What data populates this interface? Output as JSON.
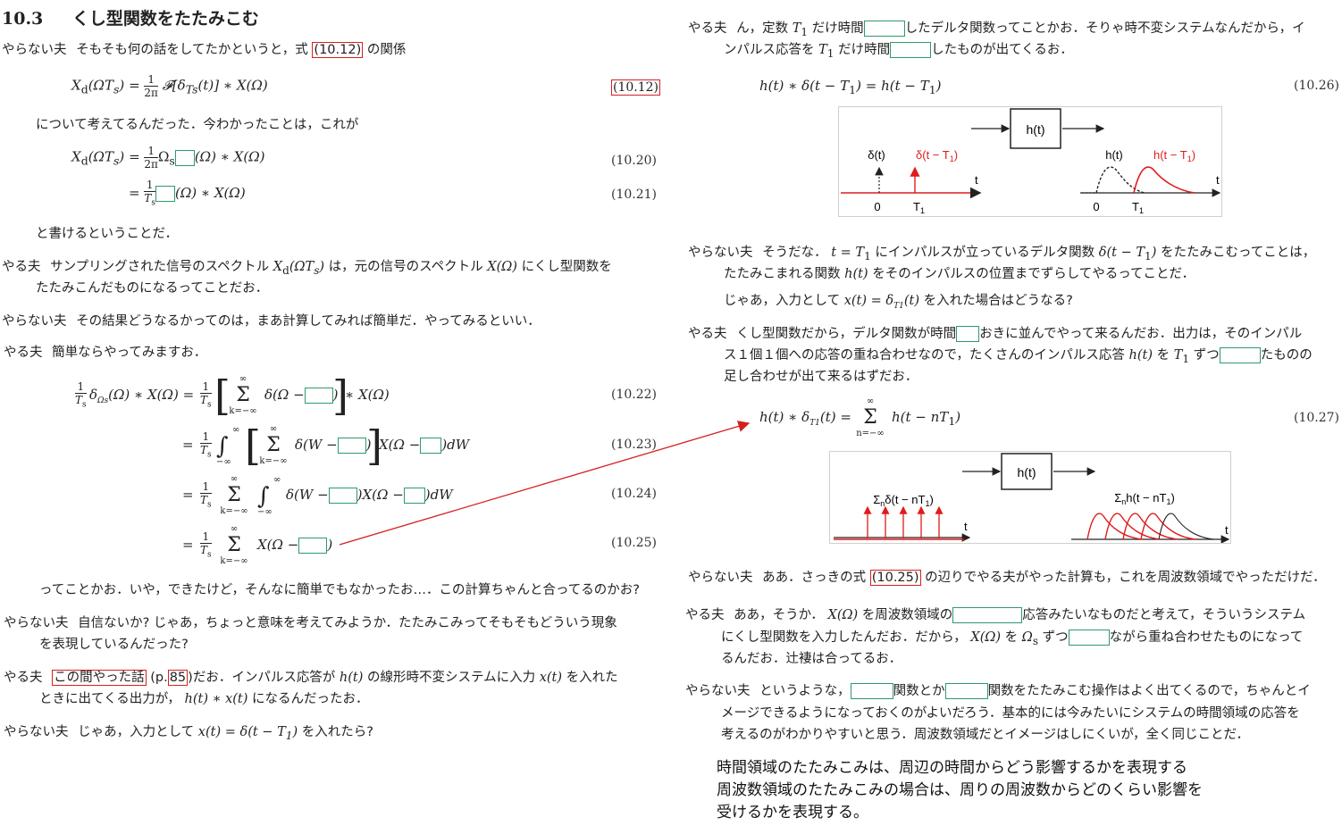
{
  "section": {
    "number": "10.3",
    "title": "くし型関数をたたみこむ"
  },
  "left": {
    "p1": {
      "speaker": "やらない夫",
      "text_a": "そもそも何の話をしてたかというと，式",
      "ref": "(10.12)",
      "text_b": "の関係"
    },
    "eq1": {
      "lhs": "X",
      "lhs_sub": "d",
      "lhs_arg": "(ΩT",
      "lhs_arg_sub": "s",
      "lhs_arg_end": ")",
      "eq": "=",
      "num": "1",
      "den": "2π",
      "rhs": "𝓕[δ",
      "rhs_sub": "Ts",
      "rhs_end": "(t)] ∗ X(Ω)",
      "no": "(10.12)"
    },
    "p2": {
      "text": "について考えてるんだった．今わかったことは，これが"
    },
    "eq2": {
      "lhs": "X",
      "lhs_sub": "d",
      "lhs_arg": "(ΩT",
      "lhs_arg_sub": "s",
      "lhs_arg_end": ")",
      "eq": "=",
      "num": "1",
      "den": "2π",
      "omega": "Ω",
      "omega_sub": "s",
      "rhs": "(Ω) ∗ X(Ω)",
      "no": "(10.20)"
    },
    "eq3": {
      "eq": "=",
      "num": "1",
      "den": "T",
      "den_sub": "s",
      "rhs": "(Ω) ∗ X(Ω)",
      "no": "(10.21)"
    },
    "p3": {
      "text": "と書けるということだ．"
    },
    "p4": {
      "speaker": "やる夫",
      "text_a": "サンプリングされた信号のスペクトル",
      "math_a": "X",
      "math_a_sub": "d",
      "math_a_arg": "(ΩT",
      "math_a_arg_sub": "s",
      "math_a_end": ")",
      "text_b": "は，元の信号のスペクトル",
      "math_b": "X(Ω)",
      "text_c": "にくし型関数を",
      "text_d": "たたみこんだものになるってことだお．"
    },
    "p5": {
      "speaker": "やらない夫",
      "text": "その結果どうなるかってのは，まあ計算してみれば簡単だ．やってみるといい．"
    },
    "p6": {
      "speaker": "やる夫",
      "text": "簡単ならやってみますお．"
    },
    "eq4": {
      "lhs_num": "1",
      "lhs_den": "T",
      "lhs_den_sub": "s",
      "delta": "δ",
      "delta_sub": "Ωs",
      "lhs_end": "(Ω) ∗ X(Ω) =",
      "num": "1",
      "den": "T",
      "den_sub": "s",
      "sum_top": "∞",
      "sum_bot": "k=−∞",
      "sum": "Σ",
      "body": "δ(Ω −",
      "close": ")",
      "tail": "∗ X(Ω)",
      "no": "(10.22)"
    },
    "eq5": {
      "eq": "=",
      "num": "1",
      "den": "T",
      "den_sub": "s",
      "int_top": "∞",
      "int_bot": "−∞",
      "int": "∫",
      "sum_top": "∞",
      "sum_bot": "k=−∞",
      "sum": "Σ",
      "body": "δ(W −",
      "mid": "X(Ω −",
      "tail": ")dW",
      "no": "(10.23)"
    },
    "eq6": {
      "eq": "=",
      "num": "1",
      "den": "T",
      "den_sub": "s",
      "sum_top": "∞",
      "sum_bot": "k=−∞",
      "sum": "Σ",
      "int_top": "∞",
      "int_bot": "−∞",
      "int": "∫",
      "body": "δ(W −",
      "mid": ")X(Ω −",
      "tail": ")dW",
      "no": "(10.24)"
    },
    "eq7": {
      "eq": "=",
      "num": "1",
      "den": "T",
      "den_sub": "s",
      "sum_top": "∞",
      "sum_bot": "k=−∞",
      "sum": "Σ",
      "body": "X(Ω −",
      "close": ")",
      "no": "(10.25)"
    },
    "p7": {
      "text": "ってことかお．いや，できたけど，そんなに簡単でもなかったお…．この計算ちゃんと合ってるのかお?"
    },
    "p8": {
      "speaker": "やらない夫",
      "text_a": "自信ないか? じゃあ，ちょっと意味を考えてみようか．たたみこみってそもそもどういう現象",
      "text_b": "を表現しているんだった?"
    },
    "p9": {
      "speaker": "やる夫",
      "ref_a": "この間やった話",
      "text_a": "(p.",
      "ref_b": "85",
      "text_b": ")だお．インパルス応答が",
      "math_a": "h(t)",
      "text_c": "の線形時不変システムに入力",
      "math_b": "x(t)",
      "text_d": "を入れた",
      "text_e": "ときに出てくる出力が，",
      "math_c": "h(t) ∗ x(t)",
      "text_f": "になるんだったお．"
    },
    "p10": {
      "speaker": "やらない夫",
      "text_a": "じゃあ，入力として",
      "math": "x(t) = δ(t − T",
      "math_sub": "1",
      "math_end": ")",
      "text_b": "を入れたら?"
    }
  },
  "right": {
    "p1": {
      "speaker": "やる夫",
      "text_a": "ん，定数",
      "math_a": "T",
      "math_a_sub": "1",
      "text_b": "だけ時間",
      "text_c": "したデルタ関数ってことかお．そりゃ時不変システムなんだから，イ",
      "text_d": "ンパルス応答を",
      "math_b": "T",
      "math_b_sub": "1",
      "text_e": "だけ時間",
      "text_f": "したものが出てくるお．"
    },
    "eq1": {
      "expr": "h(t) ∗ δ(t − T",
      "sub": "1",
      "mid": ") = h(t − T",
      "sub2": "1",
      "end": ")",
      "no": "(10.26)"
    },
    "fig1": {
      "system": "h(t)",
      "in_label": "δ(t)",
      "in_shift": "δ(t − T",
      "in_shift_sub": "1",
      "in_shift_end": ")",
      "out_label": "h(t)",
      "out_shift": "h(t − T",
      "out_shift_sub": "1",
      "out_shift_end": ")",
      "t": "t",
      "zero": "0",
      "T1": "T",
      "T1_sub": "1"
    },
    "p2": {
      "speaker": "やらない夫",
      "text_a": "そうだな．",
      "math_a": "t = T",
      "math_a_sub": "1",
      "text_b": "にインパルスが立っているデルタ関数",
      "math_b": "δ(t − T",
      "math_b_sub": "1",
      "math_b_end": ")",
      "text_c": "をたたみこむってことは，",
      "text_d": "たたみこまれる関数",
      "math_c": "h(t)",
      "text_e": "をそのインパルスの位置までずらしてやるってことだ．"
    },
    "p3": {
      "text_a": "じゃあ，入力として",
      "math": "x(t) = δ",
      "math_sub": "T1",
      "math_end": "(t)",
      "text_b": "を入れた場合はどうなる?"
    },
    "p4": {
      "speaker": "やる夫",
      "text_a": "くし型関数だから，デルタ関数が時間",
      "text_b": "おきに並んでやって来るんだお．出力は，そのインパル",
      "text_c": "ス１個１個への応答の重ね合わせなので，たくさんのインパルス応答",
      "math_a": "h(t)",
      "text_d": "を",
      "math_b": "T",
      "math_b_sub": "1",
      "text_e": "ずつ",
      "text_f": "たものの",
      "text_g": "足し合わせが出て来るはずだお．"
    },
    "eq2": {
      "lhs": "h(t) ∗ δ",
      "lhs_sub": "T1",
      "lhs_end": "(t) =",
      "sum_top": "∞",
      "sum_bot": "n=−∞",
      "sum": "Σ",
      "body": "h(t − nT",
      "body_sub": "1",
      "body_end": ")",
      "no": "(10.27)"
    },
    "fig2": {
      "system": "h(t)",
      "in_label": "Σ",
      "in_label_sub": "n",
      "in_label_end": "δ(t − nT",
      "in_label_sub2": "1",
      "in_label_close": ")",
      "out_label": "Σ",
      "out_label_sub": "n",
      "out_label_end": "h(t − nT",
      "out_label_sub2": "1",
      "out_label_close": ")",
      "t": "t"
    },
    "p5": {
      "speaker": "やらない夫",
      "text_a": "ああ．さっきの式",
      "ref": "(10.25)",
      "text_b": "の辺りでやる夫がやった計算も，これを周波数領域でやっただけだ．"
    },
    "p6": {
      "speaker": "やる夫",
      "text_a": "ああ，そうか．",
      "math_a": "X(Ω)",
      "text_b": "を周波数領域の",
      "text_c": "応答みたいなものだと考えて，そういうシステム",
      "text_d": "にくし型関数を入力したんだお．だから，",
      "math_b": "X(Ω)",
      "text_e": "を",
      "math_c": "Ω",
      "math_c_sub": "s",
      "text_f": "ずつ",
      "text_g": "ながら重ね合わせたものになって",
      "text_h": "るんだお．辻褄は合ってるお．"
    },
    "p7": {
      "speaker": "やらない夫",
      "text_a": "というような，",
      "text_b": "関数とか",
      "text_c": "関数をたたみこむ操作はよく出てくるので，ちゃんとイ",
      "text_d": "メージできるようになっておくのがよいだろう．基本的には今みたいにシステムの時間領域の応答を",
      "text_e": "考えるのがわかりやすいと思う．周波数領域だとイメージはしにくいが，全く同じことだ．"
    },
    "note": {
      "line1": "時間領域のたたみこみは、周辺の時間からどう影響するかを表現する",
      "line2": "周波数領域のたたみこみの場合は、周りの周波数からどのくらい影響を",
      "line3": "受けるかを表現する。"
    }
  },
  "colors": {
    "blank_border": "#2e9a6a",
    "ref_border": "#d62020",
    "arrow": "#d62020",
    "signal_red": "#e01b1b"
  }
}
